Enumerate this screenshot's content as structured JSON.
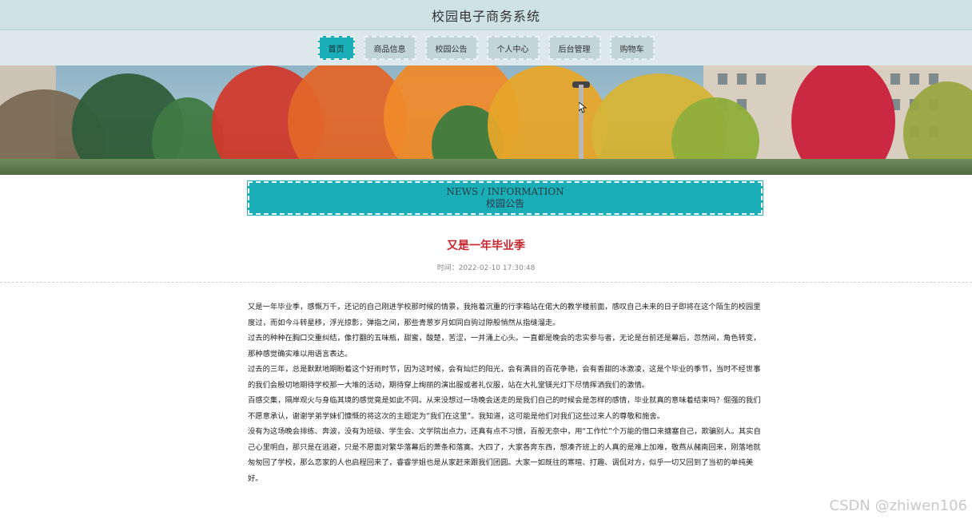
{
  "site": {
    "title": "校园电子商务系统"
  },
  "nav": {
    "items": [
      {
        "label": "首页",
        "active": true
      },
      {
        "label": "商品信息"
      },
      {
        "label": "校园公告"
      },
      {
        "label": "个人中心"
      },
      {
        "label": "后台管理"
      },
      {
        "label": "购物车"
      }
    ]
  },
  "news_banner": {
    "english": "NEWS / INFORMATION",
    "chinese": "校园公告"
  },
  "article": {
    "title": "又是一年毕业季",
    "time": "时间：2022-02-10 17:30:48",
    "paragraphs": [
      "又是一年毕业季，感慨万千，还记的自己刚进学校那时候的情景，我拖着沉重的行李箱站在偌大的教学楼前面，感叹自己未来的日子即将在这个陌生的校园里度过，而如今斗转星移，浮光掠影，弹指之间，那些青葱岁月如同白驹过隙般悄然从指缝溜走。",
      "过去的种种在胸口交重纠结，像打翻的五味瓶，甜蜜，酸楚，苦涩，一并涌上心头。一直都是晚会的忠实参与者，无论是台前还是幕后，忽然间，角色转变，那种感觉确实难以用语言表达。",
      "过去的三年，总是默默地期盼着这个好雨时节，因为这时候，会有灿烂的阳光，会有满目的百花争艳，会有香甜的冰激凌，这是个毕业的季节，当时不经世事的我们会殷切地期待学校那一大堆的活动，期待穿上绚丽的演出服或者礼仪服，站在大礼堂镁光灯下尽情挥洒我们的激情。",
      "百感交集，隔岸观火与身临其境的感觉竟是如此不同。从来没想过一场晚会送走的是我们自己的时候会是怎样的感情，毕业就真的意味着结束吗？倔强的我们不愿意承认，谢谢学弟学妹们慷慨的将这次的主题定为“我们在这里”。我知道，这可能是他们对我们这些过来人的尊敬和施舍。",
      "没有为这场晚会排练、奔波，没有为班级、学生会、文学院出点力，还真有点不习惯，百般无奈中，用“工作忙”个万能的借口来搪塞自己，欺骗别人。其实自己心里明白，那只是在逃避，只是不愿面对繁华落幕后的萧条和落寞。大四了，大家各奔东西，想凑齐班上的人真的是难上加难，敬燕从赭南回来，刚落地就匆匆回了学校，那么恋家的人也启程回来了，睿睿学姐也是从家赶来跟我们团圆。大家一如既往的寒暄、打趣、调侃对方，似乎一切又回到了当初的单纯美好。"
    ]
  },
  "watermark": {
    "text": "CSDN @zhiwen106"
  },
  "icons": {
    "cursor": "mouse-pointer-icon"
  },
  "colors": {
    "accent": "#1aaeb9",
    "title_red": "#c8252c",
    "header_bg": "#cfe2e2",
    "nav_bg": "#dde8ec"
  }
}
